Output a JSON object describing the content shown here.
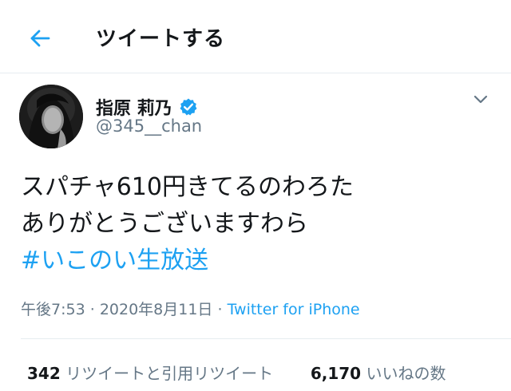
{
  "header": {
    "title": "ツイートする",
    "back_icon": "arrow-left-icon"
  },
  "accent_color": "#1da1f2",
  "tweet": {
    "author_name": "指原 莉乃",
    "verified_icon": "verified-badge-icon",
    "handle": "@345__chan",
    "menu_icon": "chevron-down-icon",
    "text_line1": "スパチャ610円きてるのわろた",
    "text_line2": "ありがとうございますわら",
    "hashtag": "#いこのい生放送",
    "time": "午後7:53",
    "separator": "·",
    "date": "2020年8月11日",
    "source": "Twitter for iPhone"
  },
  "stats": {
    "retweets_count": "342",
    "retweets_label": "リツイートと引用リツイート",
    "likes_count": "6,170",
    "likes_label": "いいねの数"
  }
}
